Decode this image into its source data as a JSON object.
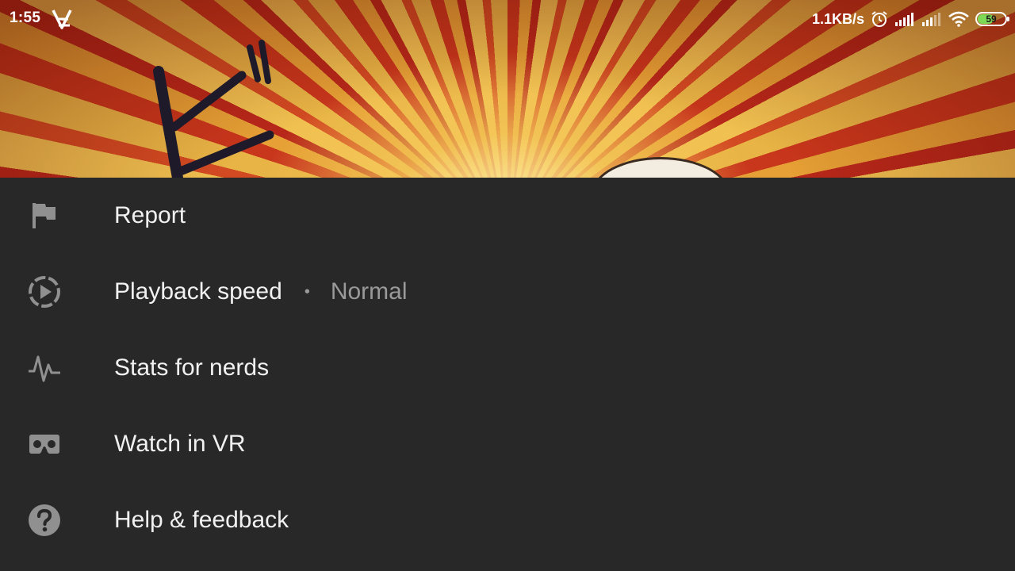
{
  "status_bar": {
    "time": "1:55",
    "app_icon": "sticky-app-icon",
    "net_speed": "1.1KB/s",
    "icons": [
      "alarm-icon",
      "signal-icon",
      "signal-icon",
      "wifi-icon"
    ],
    "battery_level": "59",
    "battery_fraction": 0.59,
    "battery_color": "#7ed957"
  },
  "menu": {
    "items": [
      {
        "icon": "flag-icon",
        "label": "Report"
      },
      {
        "icon": "playback-speed-icon",
        "label": "Playback speed",
        "separator": "•",
        "value": "Normal"
      },
      {
        "icon": "pulse-icon",
        "label": "Stats for nerds"
      },
      {
        "icon": "vr-headset-icon",
        "label": "Watch in VR"
      },
      {
        "icon": "help-icon",
        "label": "Help & feedback"
      }
    ]
  },
  "colors": {
    "sheet_background": "#282828",
    "primary_text": "#f1f1f1",
    "secondary_text": "#9a9a9a",
    "icon_color": "#909090"
  }
}
